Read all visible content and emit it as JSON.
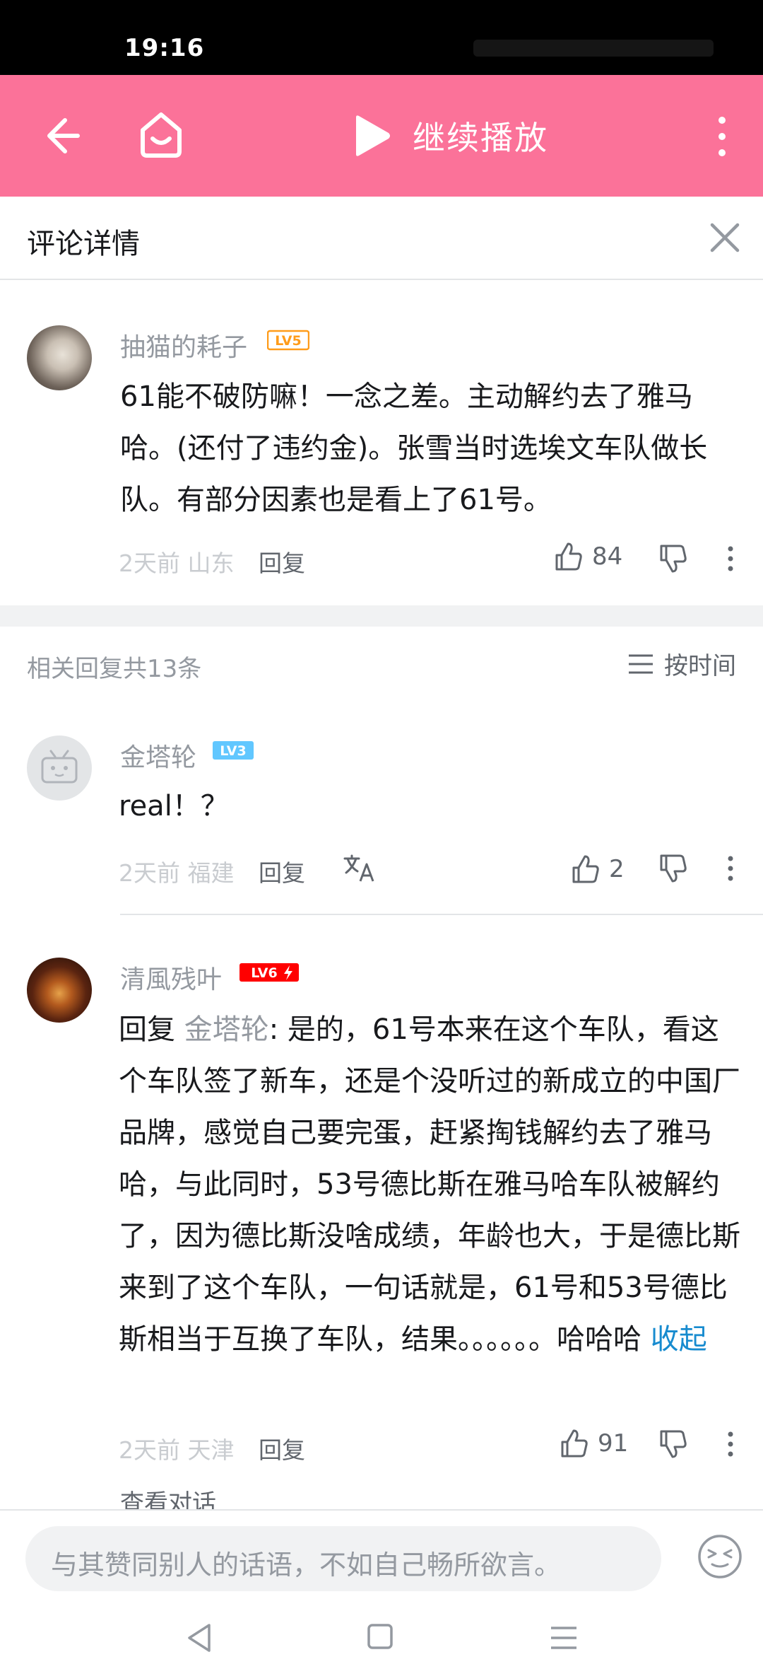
{
  "status_bar": {
    "time": "19:16"
  },
  "top_bar": {
    "continue_label": "继续播放"
  },
  "detail_header": {
    "title": "评论详情"
  },
  "main_comment": {
    "username": "抽猫的耗子",
    "level": "LV5",
    "content": "61能不破防嘛！一念之差。主动解约去了雅马哈。(还付了违约金)。张雪当时选埃文车队做长队。有部分因素也是看上了61号。",
    "time": "2天前",
    "location": "山东",
    "reply_label": "回复",
    "likes": "84"
  },
  "replies_header": {
    "total": "相关回复共13条",
    "sort_label": "按时间"
  },
  "replies": [
    {
      "username": "金塔轮",
      "level": "LV3",
      "content": "real！？",
      "time": "2天前",
      "location": "福建",
      "reply_label": "回复",
      "likes": "2"
    },
    {
      "username": "清風残叶",
      "level": "LV6",
      "reply_prefix": "回复 ",
      "at_user": "金塔轮",
      "content": ": 是的，61号本来在这个车队，看这个车队签了新车，还是个没听过的新成立的中国厂品牌，感觉自己要完蛋，赶紧掏钱解约去了雅马哈，与此同时，53号德比斯在雅马哈车队被解约了，因为德比斯没啥成绩，年龄也大，于是德比斯来到了这个车队，一句话就是，61号和53号德比斯相当于互换了车队，结果。。。。。。哈哈哈 ",
      "collapse_label": "收起",
      "time": "2天前",
      "location": "天津",
      "reply_label": "回复",
      "likes": "91",
      "view_conversation": "查看对话"
    }
  ],
  "input_bar": {
    "placeholder": "与其赞同别人的话语，不如自己畅所欲言。"
  },
  "colors": {
    "brand_pink": "#fb7299",
    "link_blue": "#178bcf",
    "lv5": "#ff9c1a",
    "lv3": "#61c7ff",
    "lv6": "#ff0000"
  },
  "icons": [
    "back-arrow-icon",
    "home-icon",
    "play-icon",
    "more-vertical-icon",
    "close-icon",
    "thumb-up-icon",
    "thumb-down-icon",
    "translate-icon",
    "sort-list-icon",
    "emoji-icon",
    "nav-back-icon",
    "nav-home-icon",
    "nav-menu-icon"
  ]
}
